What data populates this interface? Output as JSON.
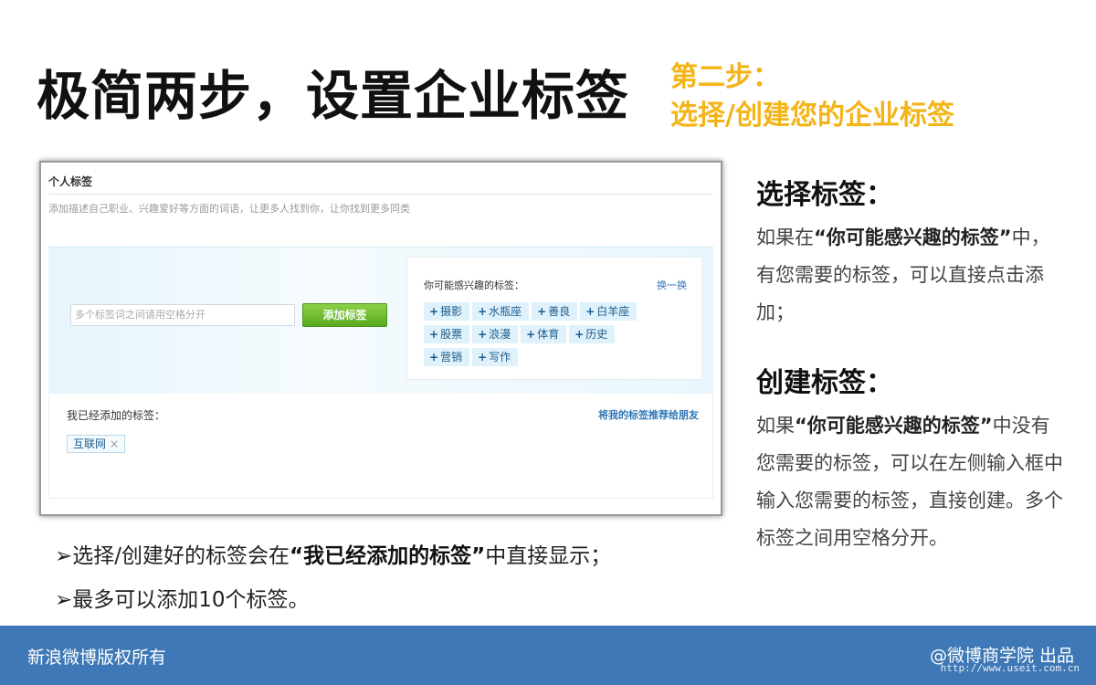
{
  "header": {
    "title": "极简两步，设置企业标签",
    "step_line1": "第二步：",
    "step_line2": "选择/创建您的企业标签"
  },
  "screenshot": {
    "section_title": "个人标签",
    "description": "添加描述自己职业、兴趣爱好等方面的词语，让更多人找到你，让你找到更多同类",
    "input_placeholder": "多个标签词之间请用空格分开",
    "add_button": "添加标签",
    "suggest_title": "你可能感兴趣的标签：",
    "refresh": "换一换",
    "suggested_tags": [
      "摄影",
      "水瓶座",
      "善良",
      "白羊座",
      "股票",
      "浪漫",
      "体育",
      "历史",
      "营销",
      "写作"
    ],
    "added_title": "我已经添加的标签：",
    "recommend_link": "将我的标签推荐给朋友",
    "added_tags": [
      "互联网"
    ],
    "remove_symbol": "×"
  },
  "notes": {
    "line1_pre": "➢选择/创建好的标签会在",
    "line1_bold": "“我已经添加的标签”",
    "line1_post": "中直接显示；",
    "line2": "➢最多可以添加10个标签。"
  },
  "right": {
    "select_title": "选择标签：",
    "select_pre": "如果在",
    "select_bold": "“你可能感兴趣的标签”",
    "select_post": "中，有您需要的标签，可以直接点击添加；",
    "create_title": "创建标签：",
    "create_pre": "如果",
    "create_bold": "“你可能感兴趣的标签”",
    "create_post": "中没有您需要的标签，可以在左侧输入框中输入您需要的标签，直接创建。多个标签之间用空格分开。"
  },
  "footer": {
    "left": "新浪微博版权所有",
    "right": "@微博商学院 出品",
    "watermark": "http://www.useit.com.cn"
  }
}
